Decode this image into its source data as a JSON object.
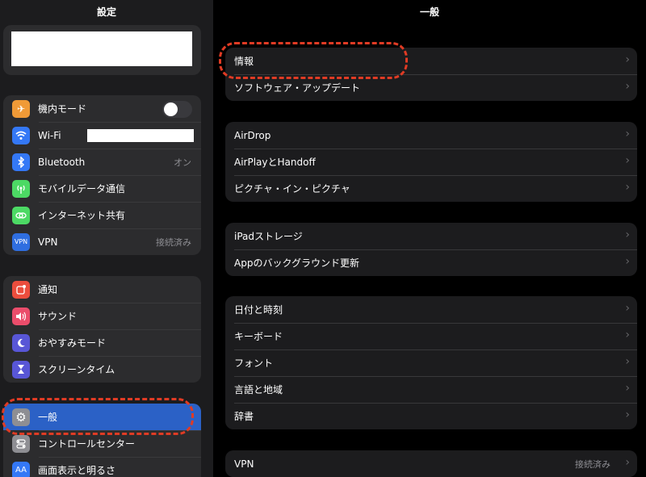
{
  "sidebar": {
    "title": "設定",
    "groups": [
      {
        "items": [
          {
            "label": "機内モード",
            "icon": "airplane-icon",
            "color": "#f09a37"
          },
          {
            "label": "Wi-Fi",
            "icon": "wifi-icon",
            "color": "#3478f6"
          },
          {
            "label": "Bluetooth",
            "icon": "bluetooth-icon",
            "color": "#3478f6",
            "value": "オン"
          },
          {
            "label": "モバイルデータ通信",
            "icon": "cellular-icon",
            "color": "#4cd964"
          },
          {
            "label": "インターネット共有",
            "icon": "hotspot-icon",
            "color": "#4cd964"
          },
          {
            "label": "VPN",
            "icon": "vpn-icon",
            "color": "#2f6ee0",
            "value": "接続済み",
            "icon_text": "VPN"
          }
        ]
      },
      {
        "items": [
          {
            "label": "通知",
            "icon": "notification-icon",
            "color": "#eb4d3d"
          },
          {
            "label": "サウンド",
            "icon": "sound-icon",
            "color": "#eb4d6b"
          },
          {
            "label": "おやすみモード",
            "icon": "moon-icon",
            "color": "#5856d6"
          },
          {
            "label": "スクリーンタイム",
            "icon": "hourglass-icon",
            "color": "#5856d6"
          }
        ]
      },
      {
        "items": [
          {
            "label": "一般",
            "icon": "gear-icon",
            "color": "#8e8e93",
            "selected": true
          },
          {
            "label": "コントロールセンター",
            "icon": "control-center-icon",
            "color": "#8e8e93"
          },
          {
            "label": "画面表示と明るさ",
            "icon": "display-icon",
            "color": "#3478f6",
            "icon_text": "AA"
          }
        ]
      }
    ]
  },
  "main": {
    "title": "一般",
    "groups": [
      {
        "items": [
          {
            "label": "情報"
          },
          {
            "label": "ソフトウェア・アップデート"
          }
        ]
      },
      {
        "items": [
          {
            "label": "AirDrop"
          },
          {
            "label": "AirPlayとHandoff"
          },
          {
            "label": "ピクチャ・イン・ピクチャ"
          }
        ]
      },
      {
        "items": [
          {
            "label": "iPadストレージ"
          },
          {
            "label": "Appのバックグラウンド更新"
          }
        ]
      },
      {
        "items": [
          {
            "label": "日付と時刻"
          },
          {
            "label": "キーボード"
          },
          {
            "label": "フォント"
          },
          {
            "label": "言語と地域"
          },
          {
            "label": "辞書"
          }
        ]
      },
      {
        "items": [
          {
            "label": "VPN",
            "value": "接続済み"
          }
        ]
      }
    ]
  },
  "chevron": "›",
  "annotation_color": "#e03b24"
}
